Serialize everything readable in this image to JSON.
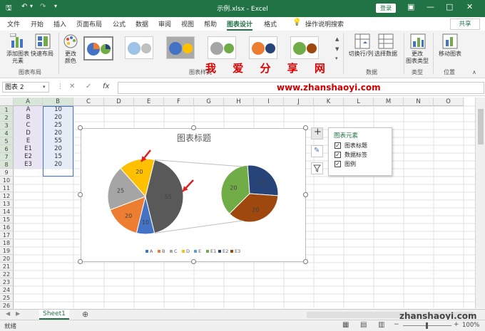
{
  "titlebar": {
    "title": "示例.xlsx  -  Excel",
    "login_label": "登录"
  },
  "tabs": [
    "文件",
    "开始",
    "插入",
    "页面布局",
    "公式",
    "数据",
    "审阅",
    "视图",
    "帮助",
    "图表设计",
    "格式"
  ],
  "active_tab": "图表设计",
  "tell_me": "操作说明搜索",
  "share_label": "共享",
  "ribbon": {
    "add_element": "添加图表\n元素",
    "quick_layout": "快速布局",
    "change_colors": "更改\n颜色",
    "switch_row_col": "切换行/列",
    "select_data": "选择数据",
    "change_type": "更改\n图表类型",
    "move_chart": "移动图表",
    "groups": {
      "layouts": "图表布局",
      "styles": "图表样式",
      "data": "数据",
      "type": "类型",
      "location": "位置"
    }
  },
  "watermark": "我 爱 分 享 网",
  "url_watermark": "www.zhanshaoyi.com",
  "site_watermark": "zhanshaoyi.com",
  "namebox": "图表 2",
  "columns": [
    "A",
    "B",
    "C",
    "D",
    "E",
    "F",
    "G",
    "H",
    "I",
    "J",
    "K",
    "L",
    "M",
    "N",
    "O"
  ],
  "rows": [
    "1",
    "2",
    "3",
    "4",
    "5",
    "6",
    "7",
    "8",
    "9",
    "10",
    "11",
    "12",
    "13",
    "14",
    "15",
    "16",
    "17",
    "18",
    "19",
    "20",
    "21",
    "22",
    "23",
    "24",
    "25",
    "26"
  ],
  "table": [
    {
      "a": "A",
      "b": "10"
    },
    {
      "a": "B",
      "b": "20"
    },
    {
      "a": "C",
      "b": "25"
    },
    {
      "a": "D",
      "b": "20"
    },
    {
      "a": "E",
      "b": "55"
    },
    {
      "a": "E1",
      "b": "20"
    },
    {
      "a": "E2",
      "b": "15"
    },
    {
      "a": "E3",
      "b": "20"
    }
  ],
  "chart": {
    "title": "图表标题",
    "legend": [
      "A",
      "B",
      "C",
      "D",
      "E",
      "E1",
      "E2",
      "E3"
    ]
  },
  "chart_data": {
    "type": "pie",
    "title": "图表标题",
    "categories": [
      "A",
      "B",
      "C",
      "D",
      "E",
      "E1",
      "E2",
      "E3"
    ],
    "values": [
      10,
      20,
      25,
      20,
      55,
      20,
      15,
      20
    ],
    "colors": [
      "#4472c4",
      "#ed7d31",
      "#a5a5a5",
      "#ffc000",
      "#5b9bd5",
      "#70ad47",
      "#264478",
      "#9e480e"
    ],
    "data_labels": [
      "10",
      "20",
      "25",
      "20",
      "55",
      "20",
      "15",
      "20"
    ]
  },
  "chart_elements": {
    "title": "图表元素",
    "items": [
      "图表标题",
      "数据标签",
      "图例"
    ]
  },
  "sheet": {
    "tab": "Sheet1",
    "status": "就绪",
    "zoom": "100%"
  }
}
